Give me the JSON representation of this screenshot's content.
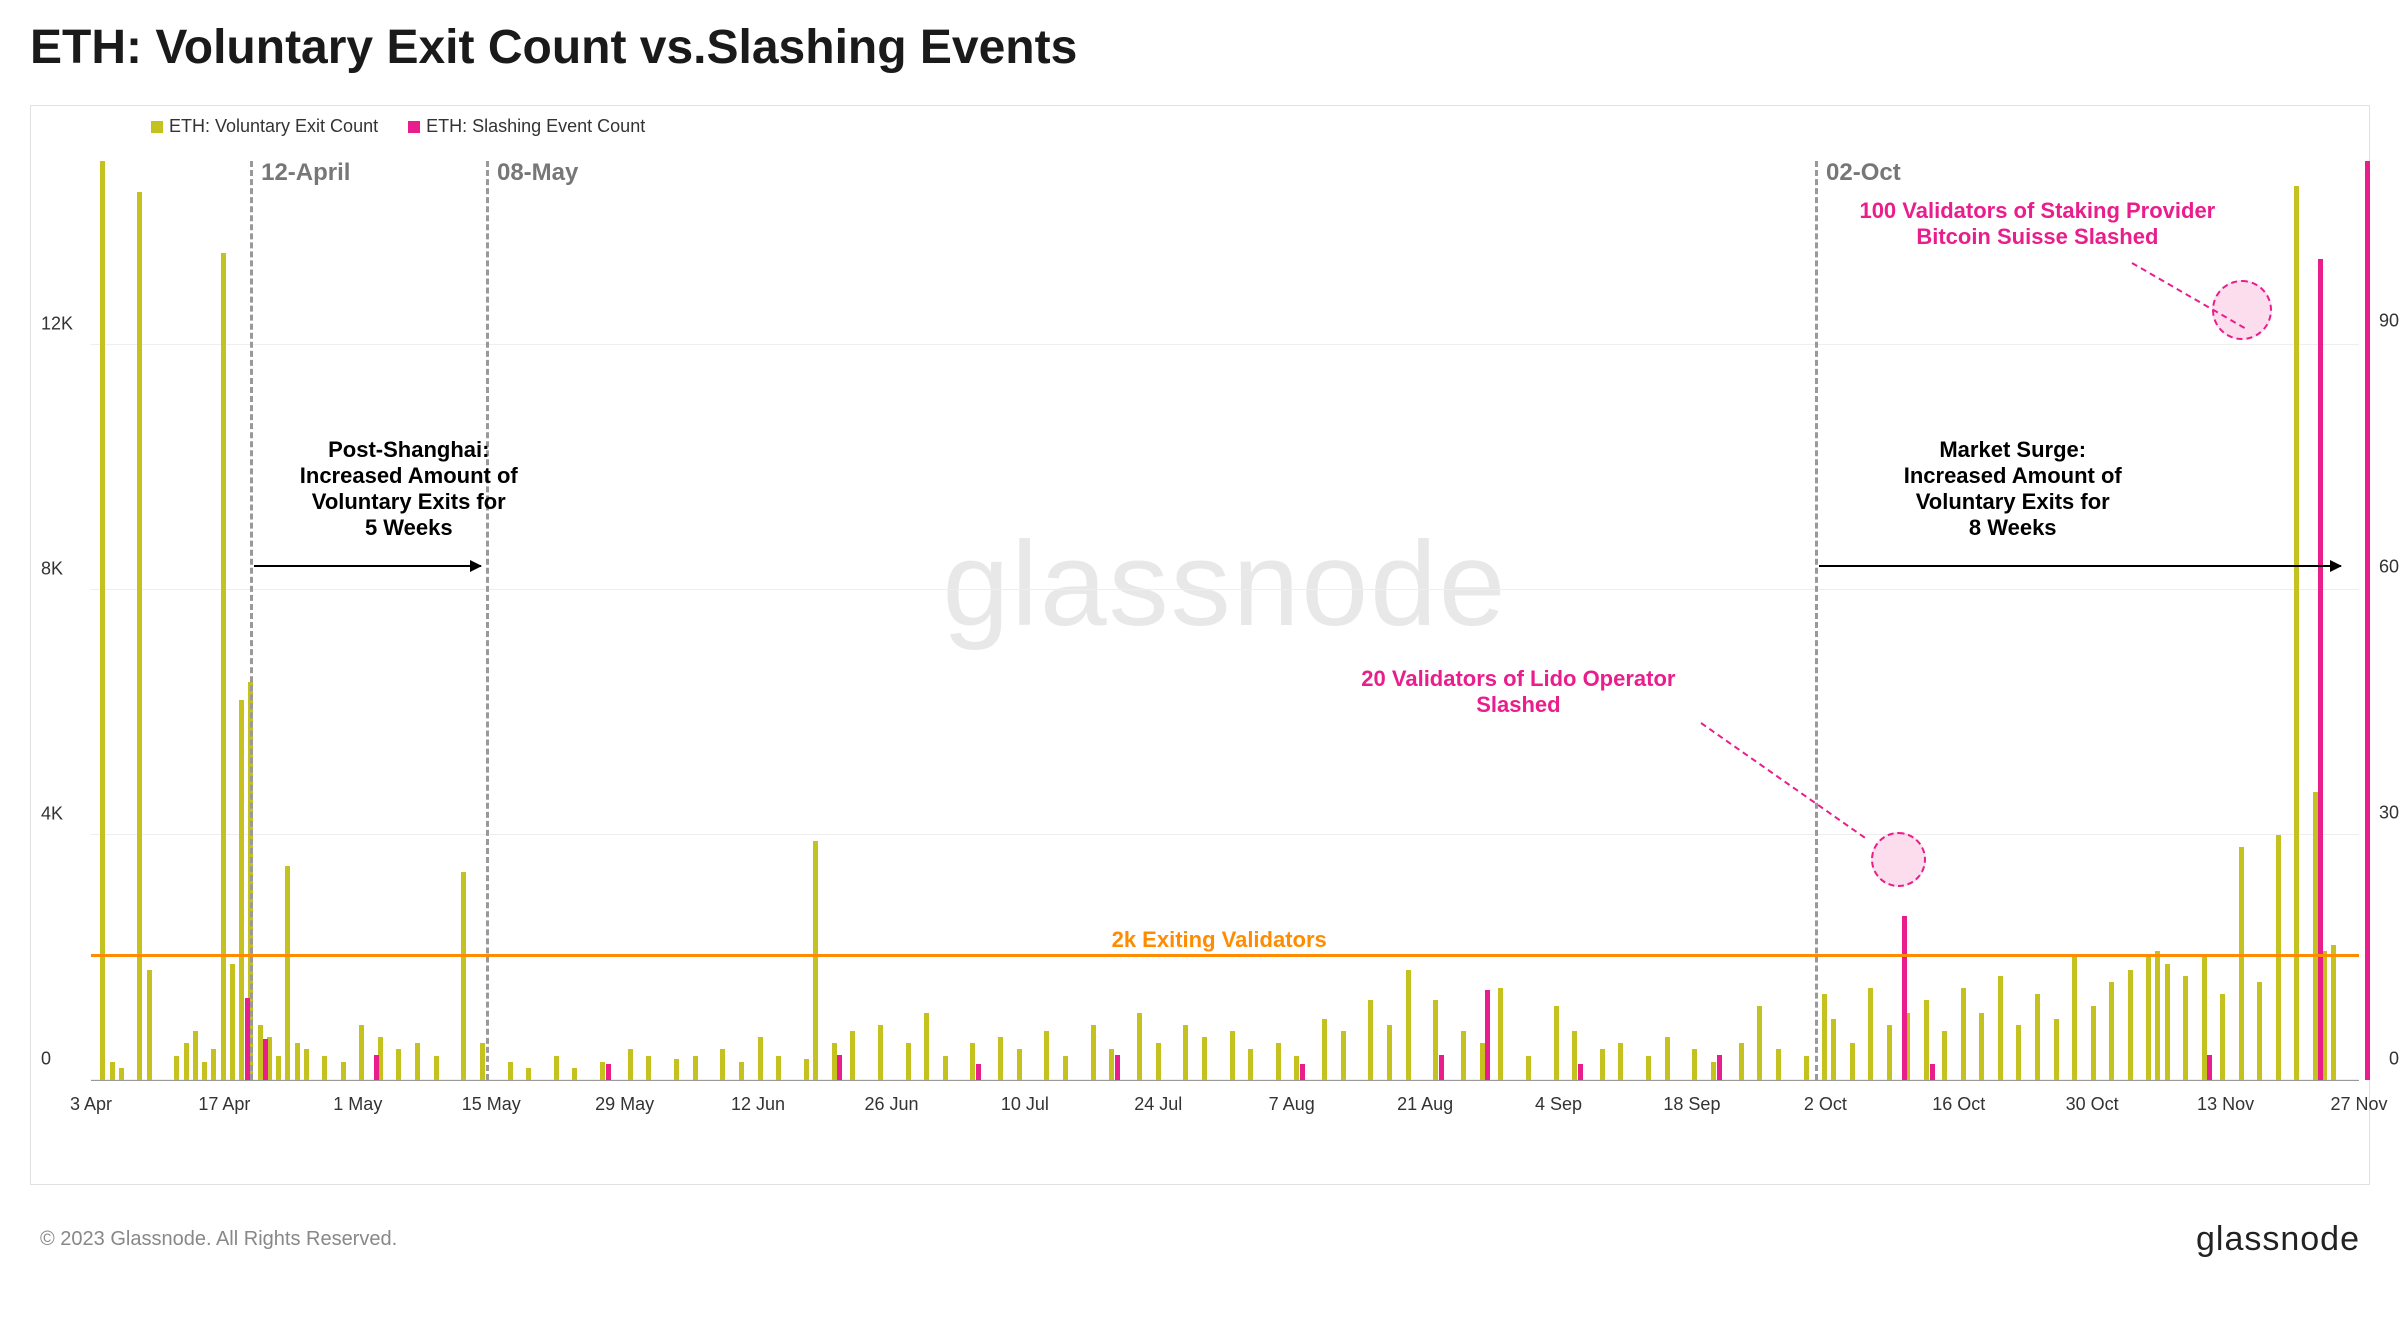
{
  "title": "ETH: Voluntary Exit Count vs.Slashing Events",
  "legend": {
    "series1": "ETH: Voluntary Exit Count",
    "series2": "ETH: Slashing Event Count",
    "color1": "#c5c11f",
    "color2": "#e91e8c"
  },
  "watermark": "glassnode",
  "copyright": "© 2023 Glassnode. All Rights Reserved.",
  "brand": "glassnode",
  "y_left": {
    "ticks": [
      0,
      "4K",
      "8K",
      "12K"
    ],
    "max": 15000
  },
  "y_right": {
    "ticks": [
      0,
      30,
      60,
      90
    ],
    "max": 112
  },
  "x_ticks": [
    "3 Apr",
    "17 Apr",
    "1 May",
    "15 May",
    "29 May",
    "12 Jun",
    "26 Jun",
    "10 Jul",
    "24 Jul",
    "7 Aug",
    "21 Aug",
    "4 Sep",
    "18 Sep",
    "2 Oct",
    "16 Oct",
    "30 Oct",
    "13 Nov",
    "27 Nov"
  ],
  "vlines": [
    {
      "label": "12-April",
      "x_pct": 7.0
    },
    {
      "label": "08-May",
      "x_pct": 17.4
    },
    {
      "label": "02-Oct",
      "x_pct": 76.0
    }
  ],
  "hline": {
    "label": "2k  Exiting Validators",
    "y_value": 2000
  },
  "annotations": {
    "post_shanghai": "Post-Shanghai:\nIncreased Amount of\nVoluntary Exits for\n5 Weeks",
    "market_surge": "Market Surge:\nIncreased Amount of\nVoluntary Exits for\n8 Weeks",
    "lido": "20 Validators of Lido Operator\nSlashed",
    "bitcoin_suisse": "100 Validators of Staking Provider\nBitcoin Suisse Slashed"
  },
  "chart_data": {
    "type": "bar",
    "title": "ETH: Voluntary Exit Count vs.Slashing Events",
    "xlabel": "",
    "ylabel_left": "Voluntary Exit Count",
    "ylabel_right": "Slashing Event Count",
    "x_range_days": 245,
    "ylim_left": [
      0,
      15000
    ],
    "ylim_right": [
      0,
      112
    ],
    "reference_line": {
      "value": 2000,
      "label": "2k Exiting Validators"
    },
    "event_markers": [
      "2023-04-12",
      "2023-05-08",
      "2023-10-02"
    ],
    "series": [
      {
        "name": "ETH: Voluntary Exit Count",
        "axis": "left",
        "color": "#c5c11f",
        "x_day": [
          1,
          2,
          3,
          5,
          6,
          9,
          10,
          11,
          12,
          13,
          14,
          15,
          16,
          17,
          18,
          19,
          20,
          21,
          22,
          23,
          25,
          27,
          29,
          31,
          33,
          35,
          37,
          40,
          42,
          45,
          47,
          50,
          52,
          55,
          58,
          60,
          63,
          65,
          68,
          70,
          72,
          74,
          77,
          78,
          80,
          82,
          85,
          88,
          90,
          92,
          95,
          98,
          100,
          103,
          105,
          108,
          110,
          113,
          115,
          118,
          120,
          123,
          125,
          128,
          130,
          133,
          135,
          138,
          140,
          142,
          145,
          148,
          150,
          152,
          155,
          158,
          160,
          163,
          165,
          168,
          170,
          173,
          175,
          178,
          180,
          182,
          185,
          187,
          188,
          190,
          192,
          194,
          196,
          198,
          200,
          202,
          204,
          206,
          208,
          210,
          212,
          214,
          216,
          218,
          220,
          222,
          223,
          224,
          226,
          228,
          230,
          232,
          234,
          236,
          238,
          240,
          241,
          242
        ],
        "values": [
          15000,
          300,
          200,
          14500,
          1800,
          400,
          600,
          800,
          300,
          500,
          13500,
          1900,
          6200,
          6500,
          900,
          700,
          400,
          3500,
          600,
          500,
          400,
          300,
          900,
          700,
          500,
          600,
          400,
          3400,
          600,
          300,
          200,
          400,
          200,
          300,
          500,
          400,
          350,
          400,
          500,
          300,
          700,
          400,
          350,
          3900,
          600,
          800,
          900,
          600,
          1100,
          400,
          600,
          700,
          500,
          800,
          400,
          900,
          500,
          1100,
          600,
          900,
          700,
          800,
          500,
          600,
          400,
          1000,
          800,
          1300,
          900,
          1800,
          1300,
          800,
          600,
          1500,
          400,
          1200,
          800,
          500,
          600,
          400,
          700,
          500,
          300,
          600,
          1200,
          500,
          400,
          1400,
          1000,
          600,
          1500,
          900,
          1100,
          1300,
          800,
          1500,
          1100,
          1700,
          900,
          1400,
          1000,
          2000,
          1200,
          1600,
          1800,
          2050,
          2100,
          1900,
          1700,
          2000,
          1400,
          3800,
          1600,
          4000,
          14600,
          4700,
          2100,
          2200,
          2000
        ],
        "note": "x_day is days since 27 Mar 2023; values are estimated voluntary exit counts"
      },
      {
        "name": "ETH: Slashing Event Count",
        "axis": "right",
        "color": "#e91e8c",
        "x_day": [
          16,
          18,
          30,
          55,
          80,
          95,
          110,
          130,
          145,
          150,
          160,
          175,
          195,
          198,
          228,
          240,
          245
        ],
        "values": [
          10,
          5,
          3,
          2,
          3,
          2,
          3,
          2,
          3,
          11,
          2,
          3,
          20,
          2,
          3,
          100,
          112
        ],
        "note": "approximate slashing event counts; two highlighted events: day≈195 (~20, Lido operator) and day≈240 (~100, Bitcoin Suisse)"
      }
    ]
  }
}
